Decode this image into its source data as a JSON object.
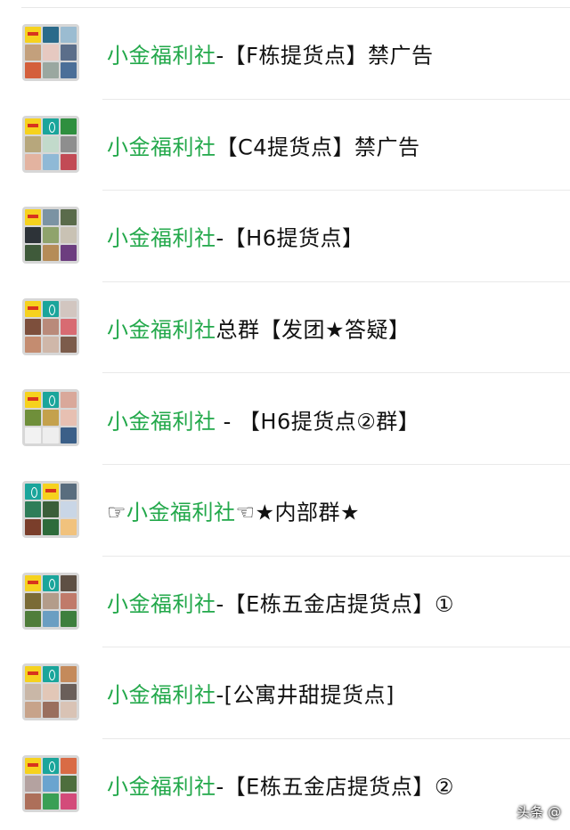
{
  "groups": [
    {
      "brand": "小金福利社",
      "rest": "-【F栋提货点】禁广告",
      "avatar_icon": "group-avatar-icon",
      "tiles": [
        "#f6d21e",
        "#2a6a8a",
        "#9bbcd1",
        "#c3a07c",
        "#e6c9c1",
        "#5b6e8a",
        "#d45f3b",
        "#9aa7a0",
        "#4b6f98"
      ]
    },
    {
      "brand": "小金福利社",
      "rest": "【C4提货点】禁广告",
      "avatar_icon": "group-avatar-icon",
      "tiles": [
        "#f6d21e",
        "#1aa59b",
        "#2f8f3f",
        "#b7a77c",
        "#c2dacb",
        "#8e8e8e",
        "#e3b3a0",
        "#8fb9d6",
        "#c24a55"
      ]
    },
    {
      "brand": "小金福利社",
      "rest": "-【H6提货点】",
      "avatar_icon": "group-avatar-icon",
      "tiles": [
        "#f6d21e",
        "#7b93a3",
        "#5a6b4b",
        "#2d3338",
        "#8fa36c",
        "#c9c2b4",
        "#3f5a3a",
        "#b58c58",
        "#6c3d7f"
      ]
    },
    {
      "brand": "小金福利社",
      "rest": "总群【发团★答疑】",
      "avatar_icon": "group-avatar-icon",
      "tiles": [
        "#f6d21e",
        "#1aa59b",
        "#d2c6c0",
        "#7d4f3c",
        "#b98a7a",
        "#d86b72",
        "#c48c70",
        "#cfb7a9",
        "#7c5c4b"
      ]
    },
    {
      "brand": "小金福利社",
      "rest": " - 【H6提货点②群】",
      "avatar_icon": "group-avatar-icon",
      "tiles": [
        "#f6d21e",
        "#1aa59b",
        "#d9a89a",
        "#6f8f3a",
        "#c4a14c",
        "#e7c0b2",
        "#f2f2f2",
        "#eeeeee",
        "#3b5f88"
      ]
    },
    {
      "brand": "小金福利社",
      "rest": "☜★内部群★",
      "prefix": "☞",
      "avatar_icon": "group-avatar-icon",
      "tiles": [
        "#1aa59b",
        "#f6d21e",
        "#596d7e",
        "#2e7d58",
        "#3b5e3a",
        "#c9d6e6",
        "#7a3e2b",
        "#2d6b3b",
        "#f1c27d"
      ]
    },
    {
      "brand": "小金福利社",
      "rest": "-【E栋五金店提货点】①",
      "avatar_icon": "group-avatar-icon",
      "tiles": [
        "#f6d21e",
        "#1aa59b",
        "#5e5044",
        "#7a6b36",
        "#b39c8a",
        "#c07a6a",
        "#4f7d3a",
        "#6b9ec2",
        "#3e7f3e"
      ]
    },
    {
      "brand": "小金福利社",
      "rest": "-[公寓井甜提货点]",
      "avatar_icon": "group-avatar-icon",
      "tiles": [
        "#f6d21e",
        "#1aa59b",
        "#c48a5b",
        "#c9b7a7",
        "#e2c7b7",
        "#6a5f5a",
        "#c7a38a",
        "#9a6f5e",
        "#d9c3b5"
      ]
    },
    {
      "brand": "小金福利社",
      "rest": "-【E栋五金店提货点】②",
      "avatar_icon": "group-avatar-icon",
      "tiles": [
        "#f6d21e",
        "#1aa59b",
        "#d96b45",
        "#b4a2a0",
        "#6aa4cf",
        "#4e6e3d",
        "#ad6f5a",
        "#3a9f55",
        "#d34b7a"
      ]
    }
  ],
  "watermark": "头条 @",
  "colors": {
    "brand_green": "#22a84a",
    "divider": "#e9e9e9"
  }
}
